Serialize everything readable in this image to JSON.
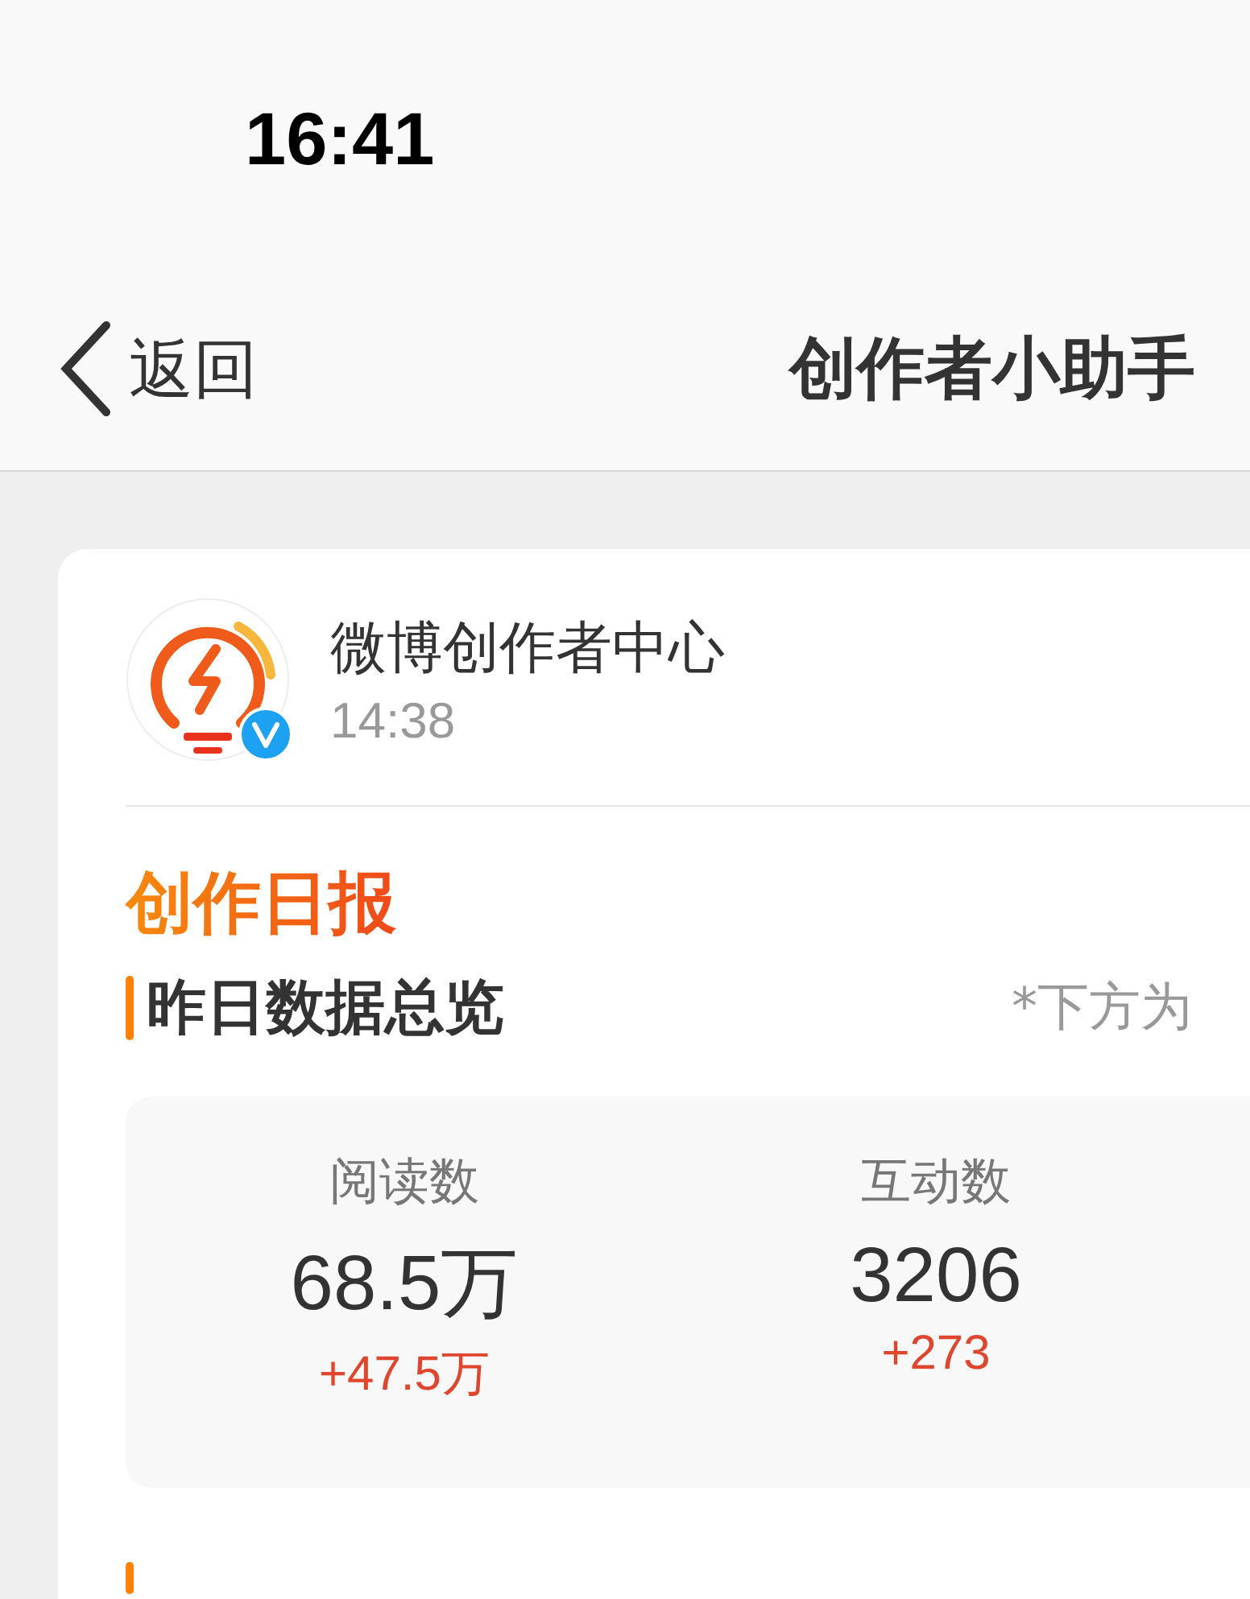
{
  "status_bar": {
    "time": "16:41"
  },
  "nav_bar": {
    "back_label": "返回",
    "title": "创作者小助手"
  },
  "message": {
    "sender": "微博创作者中心",
    "time": "14:38",
    "verified": true,
    "report_title": "创作日报",
    "section": {
      "title": "昨日数据总览",
      "note": "*下方为"
    },
    "stats": [
      {
        "label": "阅读数",
        "value": "68.5万",
        "delta": "+47.5万"
      },
      {
        "label": "互动数",
        "value": "3206",
        "delta": "+273"
      }
    ]
  }
}
